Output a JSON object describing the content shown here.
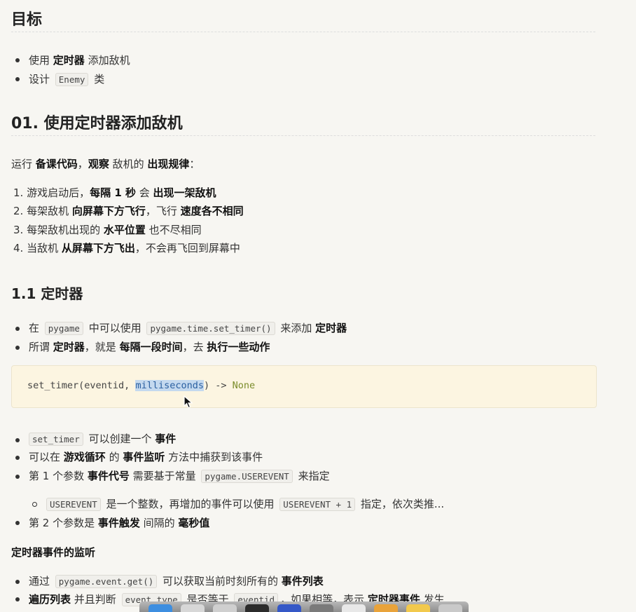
{
  "goal": {
    "title": "目标",
    "items": [
      {
        "pre": "使用 ",
        "bold": "定时器",
        "post": " 添加敌机"
      },
      {
        "pre": "设计 ",
        "code": "Enemy",
        "post": " 类"
      }
    ]
  },
  "section1": {
    "title": "01. 使用定时器添加敌机",
    "intro": {
      "a": "运行 ",
      "b1": "备课代码",
      "c": "，",
      "b2": "观察",
      "d": " 敌机的 ",
      "b3": "出现规律",
      "e": "："
    },
    "list": [
      {
        "n": "1.",
        "a": "游戏启动后，",
        "b1": "每隔 1 秒",
        "c": " 会 ",
        "b2": "出现一架敌机"
      },
      {
        "n": "2.",
        "a": "每架敌机 ",
        "b1": "向屏幕下方飞行",
        "c": "，飞行 ",
        "b2": "速度各不相同"
      },
      {
        "n": "3.",
        "a": "每架敌机出现的 ",
        "b1": "水平位置",
        "c": " 也不尽相同"
      },
      {
        "n": "4.",
        "a": "当敌机 ",
        "b1": "从屏幕下方飞出",
        "c": "，不会再飞回到屏幕中"
      }
    ]
  },
  "section11": {
    "title": "1.1 定时器",
    "bullets1": {
      "b1": {
        "a": "在 ",
        "code1": "pygame",
        "b": " 中可以使用 ",
        "code2": "pygame.time.set_timer()",
        "c": " 来添加 ",
        "bold": "定时器"
      },
      "b2": {
        "a": "所谓 ",
        "bold1": "定时器",
        "b": "，就是 ",
        "bold2": "每隔一段时间",
        "c": "，去 ",
        "bold3": "执行一些动作"
      }
    },
    "codeblock": {
      "pre": "set_timer(eventid, ",
      "sel": "milliseconds",
      "post": ") -> ",
      "ret": "None"
    },
    "bullets2": {
      "b1": {
        "code": "set_timer",
        "a": " 可以创建一个 ",
        "bold": "事件"
      },
      "b2": {
        "a": "可以在 ",
        "bold1": "游戏循环",
        "b": " 的 ",
        "bold2": "事件监听",
        "c": " 方法中捕获到该事件"
      },
      "b3": {
        "a": "第 1 个参数 ",
        "bold": "事件代号",
        "b": " 需要基于常量 ",
        "code": "pygame.USEREVENT",
        "c": " 来指定"
      },
      "sub": {
        "code1": "USEREVENT",
        "a": " 是一个整数，再增加的事件可以使用 ",
        "code2": "USEREVENT + 1",
        "b": " 指定，依次类推..."
      },
      "b4": {
        "a": "第 2 个参数是 ",
        "bold1": "事件触发",
        "b": " 间隔的 ",
        "bold2": "毫秒值"
      }
    },
    "listen_title": "定时器事件的监听",
    "bullets3": {
      "b1": {
        "a": "通过 ",
        "code": "pygame.event.get()",
        "b": " 可以获取当前时刻所有的 ",
        "bold": "事件列表"
      },
      "b2": {
        "bold1": "遍历列表",
        "a": " 并且判断 ",
        "code1": "event.type",
        "b": " 是否等于 ",
        "code2": "eventid",
        "c": "，如果相等，表示 ",
        "bold2": "定时器事件",
        "d": " 发生"
      }
    }
  },
  "colors": {
    "page": "#f7f6f2",
    "codeblock": "#fcf5e1",
    "selection": "#c4d9ef",
    "return_type": "#7a8c2a"
  }
}
